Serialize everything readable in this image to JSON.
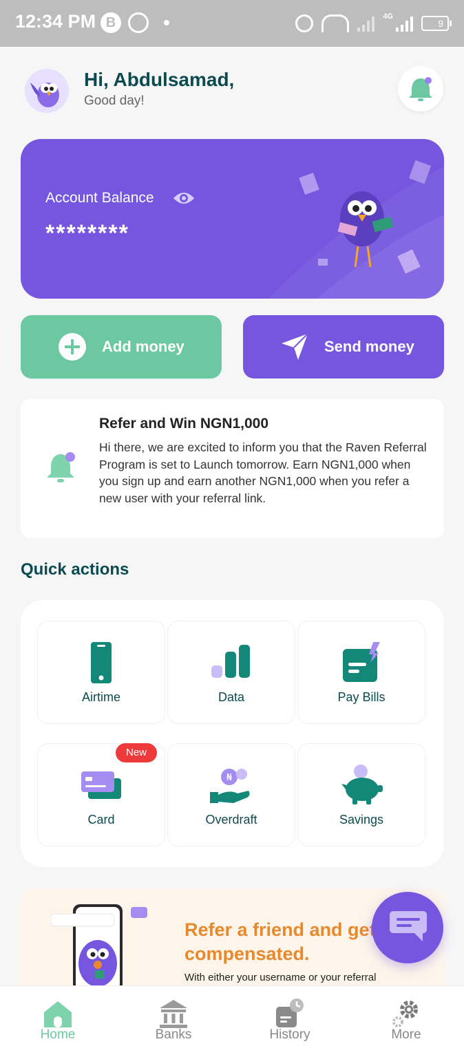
{
  "status_bar": {
    "time": "12:34 PM",
    "b_badge": "B",
    "network_label": "4G",
    "battery": "9"
  },
  "header": {
    "greeting": "Hi, Abdulsamad,",
    "subtitle": "Good day!"
  },
  "balance": {
    "label": "Account Balance",
    "value": "********"
  },
  "actions": {
    "add_money": "Add money",
    "send_money": "Send money"
  },
  "notice": {
    "title": "Refer and Win NGN1,000",
    "body": "Hi there, we are excited to inform you that the Raven Referral Program is set to Launch tomorrow. Earn NGN1,000 when you sign up and earn another NGN1,000 when you refer a new user with your referral link."
  },
  "quick_actions": {
    "title": "Quick actions",
    "items": [
      {
        "label": "Airtime",
        "icon": "phone-icon"
      },
      {
        "label": "Data",
        "icon": "data-bars-icon"
      },
      {
        "label": "Pay Bills",
        "icon": "bill-icon"
      },
      {
        "label": "Card",
        "icon": "card-icon",
        "badge": "New"
      },
      {
        "label": "Overdraft",
        "icon": "overdraft-icon"
      },
      {
        "label": "Savings",
        "icon": "piggy-bank-icon"
      }
    ]
  },
  "promo": {
    "title": "Refer a friend and get compensated.",
    "subtitle": "With either your username or your referral"
  },
  "bottom_nav": {
    "items": [
      {
        "label": "Home",
        "active": true
      },
      {
        "label": "Banks",
        "active": false
      },
      {
        "label": "History",
        "active": false
      },
      {
        "label": "More",
        "active": false
      }
    ]
  },
  "colors": {
    "primary": "#7656df",
    "accent_green": "#6cc8a0",
    "dark_teal": "#0b4a4f",
    "teal_icon": "#138778",
    "badge_red": "#ee3a3a",
    "promo_orange": "#e9892e"
  }
}
